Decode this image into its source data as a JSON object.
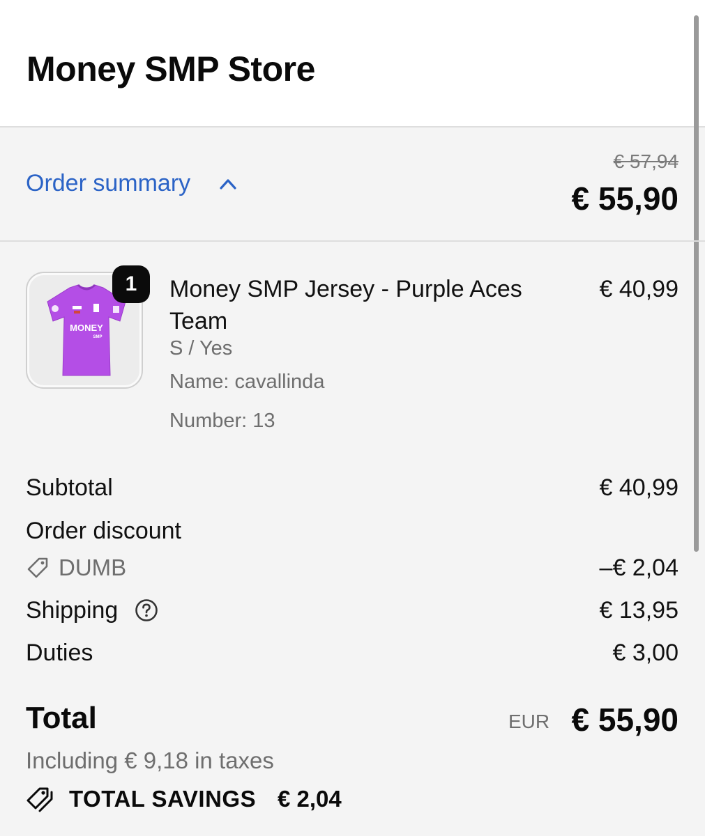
{
  "store": {
    "title": "Money SMP Store"
  },
  "summary": {
    "toggle_label": "Order summary",
    "original_price": "€ 57,94",
    "current_price": "€ 55,90"
  },
  "item": {
    "quantity": "1",
    "title": "Money SMP Jersey - Purple Aces Team",
    "price": "€ 40,99",
    "variant": "S / Yes",
    "name_line": "Name: cavallinda",
    "number_line": "Number: 13",
    "image_icon": "purple-jersey",
    "jersey_text": "MONEY",
    "jersey_subtext": "SMP"
  },
  "totals": {
    "subtotal_label": "Subtotal",
    "subtotal_value": "€ 40,99",
    "discount_label": "Order discount",
    "discount_code": "DUMB",
    "discount_value": "–€ 2,04",
    "shipping_label": "Shipping",
    "shipping_value": "€ 13,95",
    "duties_label": "Duties",
    "duties_value": "€ 3,00",
    "total_label": "Total",
    "total_currency": "EUR",
    "total_value": "€ 55,90",
    "taxes_note": "Including € 9,18 in taxes",
    "savings_label": "TOTAL SAVINGS",
    "savings_value": "€ 2,04"
  },
  "colors": {
    "link": "#2b63c6",
    "jersey": "#b44ee6",
    "muted_text": "#6e6e6e",
    "background": "#f4f4f4"
  }
}
